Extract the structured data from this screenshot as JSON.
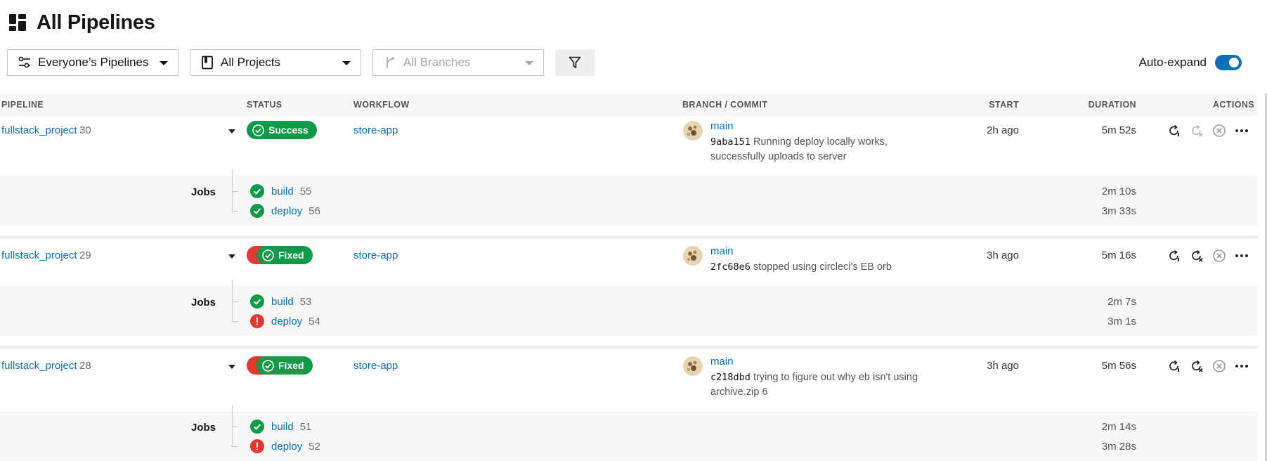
{
  "header": {
    "title": "All Pipelines"
  },
  "filters": {
    "pipelines": "Everyone’s Pipelines",
    "projects": "All Projects",
    "branches_placeholder": "All Branches",
    "auto_expand_label": "Auto-expand",
    "auto_expand_on": true
  },
  "table": {
    "columns": [
      "PIPELINE",
      "STATUS",
      "WORKFLOW",
      "BRANCH / COMMIT",
      "START",
      "DURATION",
      "ACTIONS"
    ],
    "jobs_label": "Jobs"
  },
  "pipelines": [
    {
      "project": "fullstack_project",
      "number": "30",
      "status": "Success",
      "workflow": "store-app",
      "branch": "main",
      "sha": "9aba151",
      "message": "Running deploy locally works, successfully uploads to server",
      "start": "2h ago",
      "duration": "5m 52s",
      "jobs": [
        {
          "name": "build",
          "number": "55",
          "status": "success",
          "duration": "2m 10s"
        },
        {
          "name": "deploy",
          "number": "56",
          "status": "success",
          "duration": "3m 33s"
        }
      ]
    },
    {
      "project": "fullstack_project",
      "number": "29",
      "status": "Fixed",
      "workflow": "store-app",
      "branch": "main",
      "sha": "2fc68e6",
      "message": "stopped using circleci's EB orb",
      "start": "3h ago",
      "duration": "5m 16s",
      "jobs": [
        {
          "name": "build",
          "number": "53",
          "status": "success",
          "duration": "2m 7s"
        },
        {
          "name": "deploy",
          "number": "54",
          "status": "failed",
          "duration": "3m 1s"
        }
      ]
    },
    {
      "project": "fullstack_project",
      "number": "28",
      "status": "Fixed",
      "workflow": "store-app",
      "branch": "main",
      "sha": "c218dbd",
      "message": "trying to figure out why eb isn't using archive.zip 6",
      "start": "3h ago",
      "duration": "5m 56s",
      "jobs": [
        {
          "name": "build",
          "number": "51",
          "status": "success",
          "duration": "2m 14s"
        },
        {
          "name": "deploy",
          "number": "52",
          "status": "failed",
          "duration": "3m 28s"
        }
      ]
    }
  ],
  "colors": {
    "link": "#0c70b7",
    "success": "#0e9a46",
    "failed": "#e5372f",
    "toggle": "#0c70b7"
  },
  "icons": [
    "dashboard-icon",
    "pipeline-filter-icon",
    "project-book-icon",
    "branch-icon",
    "funnel-icon",
    "rerun-icon",
    "rerun-failed-icon",
    "cancel-icon",
    "more-icon",
    "check-circle-icon",
    "error-circle-icon"
  ]
}
